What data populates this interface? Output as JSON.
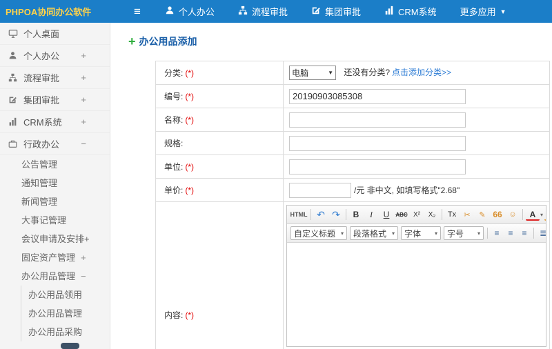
{
  "topbar": {
    "logo": "PHPOA协同办公软件",
    "menu_icon": "≡",
    "nav": [
      {
        "label": "个人办公"
      },
      {
        "label": "流程审批"
      },
      {
        "label": "集团审批"
      },
      {
        "label": "CRM系统"
      },
      {
        "label": "更多应用",
        "caret": "▼"
      }
    ]
  },
  "sidebar": {
    "items": [
      {
        "label": "个人桌面",
        "toggle": ""
      },
      {
        "label": "个人办公",
        "toggle": "+"
      },
      {
        "label": "流程审批",
        "toggle": "+"
      },
      {
        "label": "集团审批",
        "toggle": "+"
      },
      {
        "label": "CRM系统",
        "toggle": "+"
      },
      {
        "label": "行政办公",
        "toggle": "−"
      }
    ],
    "admin_children": [
      {
        "label": "公告管理",
        "toggle": ""
      },
      {
        "label": "通知管理",
        "toggle": ""
      },
      {
        "label": "新闻管理",
        "toggle": ""
      },
      {
        "label": "大事记管理",
        "toggle": ""
      },
      {
        "label": "会议申请及安排+",
        "toggle": ""
      },
      {
        "label": "固定资产管理",
        "toggle": "+"
      },
      {
        "label": "办公用品管理",
        "toggle": "−"
      }
    ],
    "supplies_children": [
      {
        "label": "办公用品领用"
      },
      {
        "label": "办公用品管理"
      },
      {
        "label": "办公用品采购"
      }
    ]
  },
  "main": {
    "title": "办公用品添加",
    "plus_icon": "+",
    "form": {
      "category": {
        "label": "分类:",
        "required": "(*)",
        "select_value": "电脑",
        "select_caret": "▼",
        "hint": "还没有分类?",
        "link": "点击添加分类>>"
      },
      "code": {
        "label": "编号:",
        "required": "(*)",
        "value": "20190903085308"
      },
      "name": {
        "label": "名称:",
        "required": "(*)",
        "value": ""
      },
      "spec": {
        "label": "规格:",
        "required": "",
        "value": ""
      },
      "unit": {
        "label": "单位:",
        "required": "(*)",
        "value": ""
      },
      "price": {
        "label": "单价:",
        "required": "(*)",
        "value": "",
        "suffix": "/元 非中文, 如填写格式\"2.68\""
      },
      "content": {
        "label": "内容:",
        "required": "(*)"
      }
    },
    "editor": {
      "caret": "▾",
      "row1": [
        {
          "name": "source-icon",
          "glyph": "HTML"
        },
        {
          "name": "undo-icon",
          "glyph": "↶"
        },
        {
          "name": "redo-icon",
          "glyph": "↷"
        },
        {
          "name": "bold-icon",
          "glyph": "B"
        },
        {
          "name": "italic-icon",
          "glyph": "I"
        },
        {
          "name": "underline-icon",
          "glyph": "U"
        },
        {
          "name": "strikethrough-icon",
          "glyph": "ABC"
        },
        {
          "name": "superscript-icon",
          "glyph": "X²"
        },
        {
          "name": "subscript-icon",
          "glyph": "X₂"
        },
        {
          "name": "remove-format-icon",
          "glyph": "Tx"
        },
        {
          "name": "eraser-icon",
          "glyph": "✂"
        },
        {
          "name": "format-painter-icon",
          "glyph": "✎"
        },
        {
          "name": "blockquote-icon",
          "glyph": "66"
        },
        {
          "name": "emotion-icon",
          "glyph": "☺"
        },
        {
          "name": "font-color-icon",
          "glyph": "A"
        },
        {
          "name": "highlight-color-icon",
          "glyph": "ab"
        }
      ],
      "row2_dropdowns": [
        {
          "label": "自定义标题",
          "caret": "▾"
        },
        {
          "label": "段落格式",
          "caret": "▾"
        },
        {
          "label": "字体",
          "caret": "▾"
        },
        {
          "label": "字号",
          "caret": "▾"
        }
      ],
      "row2_icons": [
        {
          "glyph": "≡"
        },
        {
          "glyph": "≡"
        },
        {
          "glyph": "≡"
        },
        {
          "glyph": "≣"
        },
        {
          "glyph": "≔"
        },
        {
          "glyph": "»"
        }
      ]
    }
  }
}
